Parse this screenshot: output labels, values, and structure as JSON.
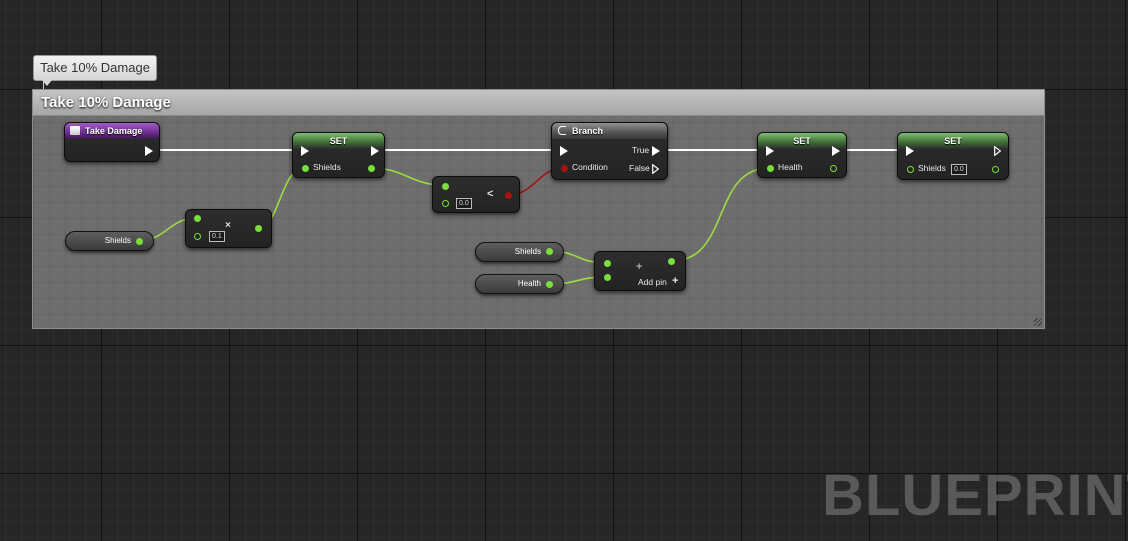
{
  "graph": {
    "comment_tag": "Take 10% Damage",
    "comment_title": "Take 10% Damage",
    "watermark": "BLUEPRINT"
  },
  "nodes": {
    "event": {
      "title": "Take Damage"
    },
    "set_shields_1": {
      "title": "SET",
      "pin_label": "Shields"
    },
    "branch": {
      "title": "Branch",
      "condition_label": "Condition",
      "true_label": "True",
      "false_label": "False"
    },
    "compare": {
      "value": "0.0",
      "operator": "<"
    },
    "set_health": {
      "title": "SET",
      "pin_label": "Health"
    },
    "set_shields_2": {
      "title": "SET",
      "pin_label": "Shields",
      "value": "0.0"
    },
    "get_shields_1": {
      "label": "Shields"
    },
    "multiply": {
      "value": "0.1",
      "operator": "×"
    },
    "get_shields_2": {
      "label": "Shields"
    },
    "get_health": {
      "label": "Health"
    },
    "add": {
      "operator": "+",
      "add_pin_label": "Add pin",
      "add_pin_icon": "+"
    }
  },
  "colors": {
    "exec_wire": "#ffffff",
    "float_wire": "#9bdc44",
    "bool_wire": "#a31212",
    "float_pin": "#79e03a",
    "event_header": "#6a2d8c",
    "var_header": "#3c6a34"
  }
}
